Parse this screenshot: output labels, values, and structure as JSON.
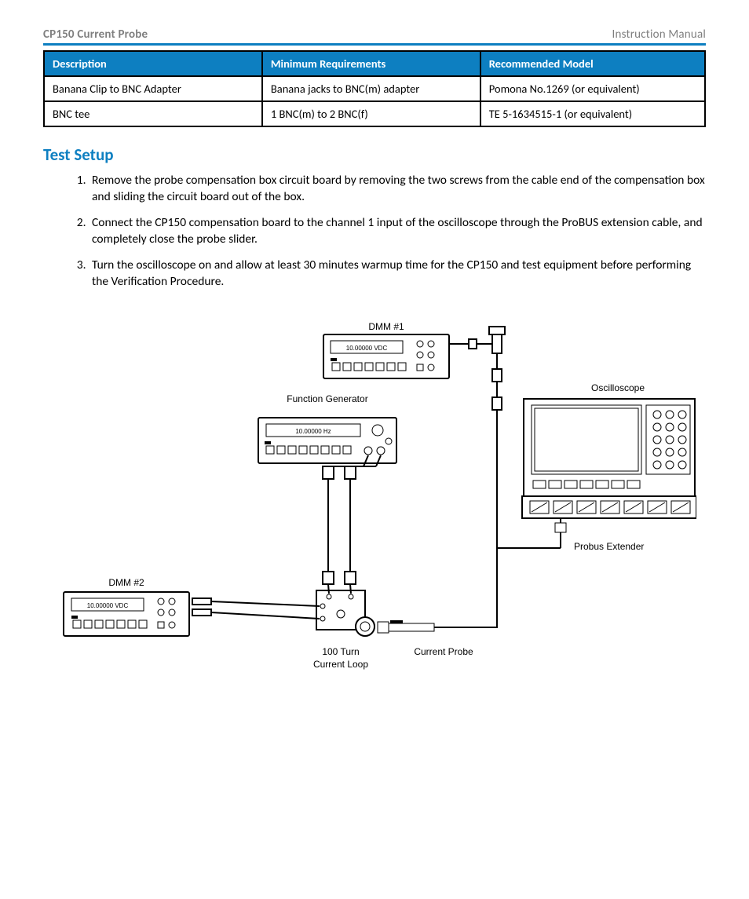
{
  "header": {
    "left": "CP150 Current Probe",
    "right": "Instruction Manual"
  },
  "table": {
    "headers": [
      "Description",
      "Minimum Requirements",
      "Recommended Model"
    ],
    "rows": [
      [
        "Banana Clip to BNC Adapter",
        "Banana jacks to BNC(m) adapter",
        "Pomona No.1269 (or equivalent)"
      ],
      [
        "BNC tee",
        "1 BNC(m) to 2 BNC(f)",
        "TE 5-1634515-1 (or equivalent)"
      ]
    ]
  },
  "section_title": "Test Setup",
  "steps": [
    "Remove the probe compensation box circuit board by removing the two screws from the cable end of the compensation box and sliding the circuit board out of the box.",
    "Connect the CP150 compensation board to the channel 1 input of the oscilloscope through the ProBUS extension cable, and completely close the probe slider.",
    "Turn the oscilloscope on and allow at least 30 minutes warmup time for the CP150 and test equipment before performing the Verification Procedure."
  ],
  "figure": {
    "dmm1_label": "DMM #1",
    "dmm2_label": "DMM #2",
    "oscilloscope_label": "Oscilloscope",
    "function_generator_label": "Function Generator",
    "probus_extender_label": "Probus Extender",
    "current_probe_label": "Current Probe",
    "loop_label_line1": "100 Turn",
    "loop_label_line2": "Current Loop",
    "dmm_display": "10.00000 VDC",
    "fg_display": "10.00000 Hz"
  }
}
